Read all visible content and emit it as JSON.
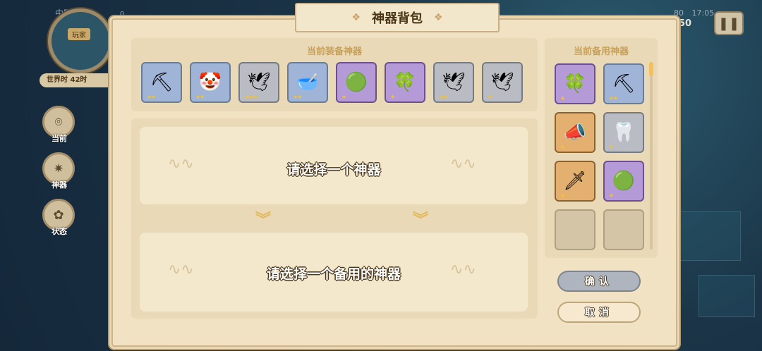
{
  "statusbar": {
    "carrier": "中国电信",
    "signal_value": "0",
    "battery": "80",
    "time": "17:05"
  },
  "map": {
    "label": "玩家",
    "world_time": "世界时 42时"
  },
  "side_buttons": [
    {
      "icon": "location-icon",
      "label": "当前"
    },
    {
      "icon": "artifact-icon",
      "label": "神器"
    },
    {
      "icon": "status-icon",
      "label": "状态"
    }
  ],
  "top_score": "50",
  "dialog": {
    "title": "神器背包",
    "equipped_title": "当前装备神器",
    "backup_title": "当前备用神器",
    "select_prompt": "请选择一个神器",
    "select_backup_prompt": "请选择一个备用的神器",
    "confirm_label": "确认",
    "cancel_label": "取消"
  },
  "equipped": [
    {
      "icon": "pickaxe-icon",
      "glyph": "⛏",
      "rarity": "blue",
      "stars": "★★"
    },
    {
      "icon": "clown-icon",
      "glyph": "🤡",
      "rarity": "blue",
      "stars": "★★"
    },
    {
      "icon": "wings-icon",
      "glyph": "🕊",
      "rarity": "gray",
      "stars": "★★★"
    },
    {
      "icon": "bowl-icon",
      "glyph": "🥣",
      "rarity": "blue",
      "stars": "★★"
    },
    {
      "icon": "slime-icon",
      "glyph": "🟢",
      "rarity": "purple",
      "stars": "★"
    },
    {
      "icon": "cannon-icon",
      "glyph": "🍀",
      "rarity": "purple",
      "stars": "★"
    },
    {
      "icon": "wings-icon",
      "glyph": "🕊",
      "rarity": "gray",
      "stars": "★★"
    },
    {
      "icon": "wings-icon",
      "glyph": "🕊",
      "rarity": "gray",
      "stars": "★"
    }
  ],
  "backup": [
    {
      "icon": "cannon-icon",
      "glyph": "🍀",
      "rarity": "purple",
      "stars": "★"
    },
    {
      "icon": "pickaxe-icon",
      "glyph": "⛏",
      "rarity": "blue",
      "stars": "★★"
    },
    {
      "icon": "megaphone-icon",
      "glyph": "📣",
      "rarity": "orange",
      "stars": "★"
    },
    {
      "icon": "fangs-icon",
      "glyph": "🦷",
      "rarity": "gray",
      "stars": "★"
    },
    {
      "icon": "spear-icon",
      "glyph": "🗡",
      "rarity": "orange",
      "stars": "★"
    },
    {
      "icon": "slime-icon",
      "glyph": "🟢",
      "rarity": "purple",
      "stars": "★"
    },
    {
      "icon": "empty-slot-icon",
      "glyph": "",
      "rarity": "empty",
      "stars": ""
    },
    {
      "icon": "empty-slot-icon",
      "glyph": "",
      "rarity": "empty",
      "stars": ""
    }
  ],
  "colors": {
    "panel": "#f0e2c2",
    "section_title": "#c8a15a",
    "star": "#f2c232"
  }
}
